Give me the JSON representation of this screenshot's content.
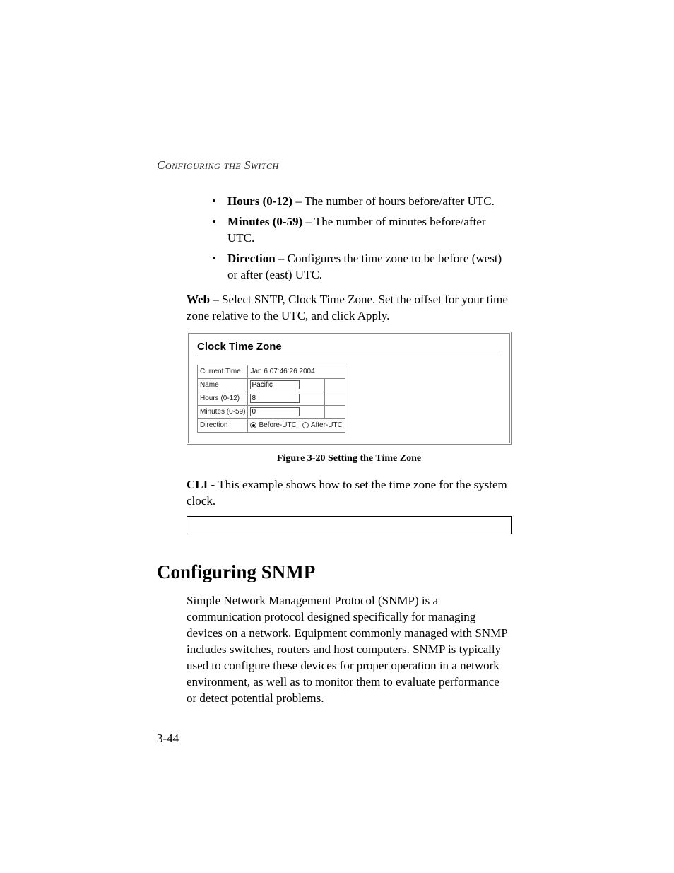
{
  "header": {
    "running": "Configuring the Switch"
  },
  "bullets": {
    "b1": {
      "term": "Hours (0-12)",
      "desc": " – The number of hours before/after UTC."
    },
    "b2": {
      "term": "Minutes (0-59)",
      "desc": " – The number of minutes before/after UTC."
    },
    "b3": {
      "term": "Direction",
      "desc": " – Configures the time zone to be before (west) or after (east) UTC."
    }
  },
  "web_para": {
    "lead": "Web",
    "rest": " – Select SNTP, Clock Time Zone. Set the offset for your time zone relative to the UTC, and click Apply."
  },
  "figure": {
    "title": "Clock Time Zone",
    "rows": {
      "current_time": {
        "label": "Current Time",
        "value": "Jan 6 07:46:26 2004"
      },
      "name": {
        "label": "Name",
        "value": "Pacific"
      },
      "hours": {
        "label": "Hours (0-12)",
        "value": "8"
      },
      "minutes": {
        "label": "Minutes (0-59)",
        "value": "0"
      },
      "direction": {
        "label": "Direction",
        "opt1": "Before-UTC",
        "opt2": "After-UTC"
      }
    },
    "caption": "Figure 3-20  Setting the Time Zone"
  },
  "cli_para": {
    "lead": "CLI - ",
    "rest": "This example shows how to set the time zone for the system clock."
  },
  "section": {
    "heading": "Configuring SNMP",
    "body": "Simple Network Management Protocol (SNMP) is a communication protocol designed specifically for managing devices on a network. Equipment commonly managed with SNMP includes switches, routers and host computers. SNMP is typically used to configure these devices for proper operation in a network environment, as well as to monitor them to evaluate performance or detect potential problems."
  },
  "page_number": "3-44"
}
